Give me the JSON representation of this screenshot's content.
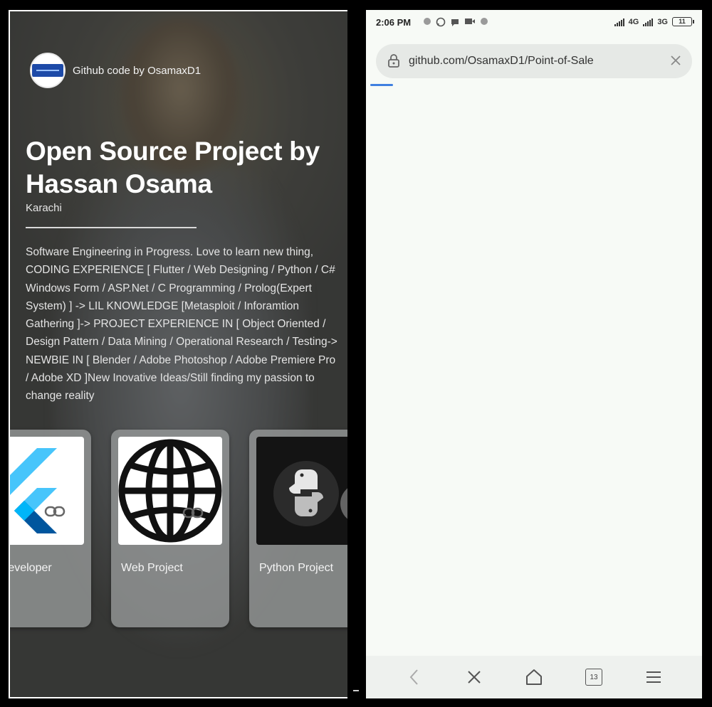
{
  "left_phone": {
    "brand": {
      "text": "Github code by OsamaxD1",
      "logo_icon": "brand-logo-icon"
    },
    "profile": {
      "title": "Open Source Project by Hassan Osama",
      "location": "Karachi",
      "bio": "Software Engineering in Progress. Love to learn new thing, CODING EXPERIENCE [ Flutter / Web Designing / Python / C# Windows Form / ASP.Net / C Programming / Prolog(Expert System) ] -> LIL KNOWLEDGE [Metasploit / Inforamtion Gathering ]-> PROJECT EXPERIENCE IN [ Object Oriented / Design Pattern / Data Mining / Operational Research / Testing-> NEWBIE IN [ Blender / Adobe Photoshop / Adobe Premiere Pro / Adobe XD ]New Inovative Ideas/Still finding my passion to change reality"
    },
    "cards": [
      {
        "label": "r Developer",
        "icon": "flutter-logo-icon"
      },
      {
        "label": "Web Project",
        "icon": "globe-icon"
      },
      {
        "label": "Python Project",
        "icon": "python-logo-icon"
      }
    ]
  },
  "right_phone": {
    "status": {
      "time": "2:06 PM",
      "net1": "4G",
      "net2": "3G",
      "battery": "11"
    },
    "browser": {
      "url": "github.com/OsamaxD1/Point-of-Sale",
      "tab_count": "13"
    },
    "colors": {
      "accent": "#3f7fe0",
      "page_bg": "#f7faf6"
    }
  }
}
